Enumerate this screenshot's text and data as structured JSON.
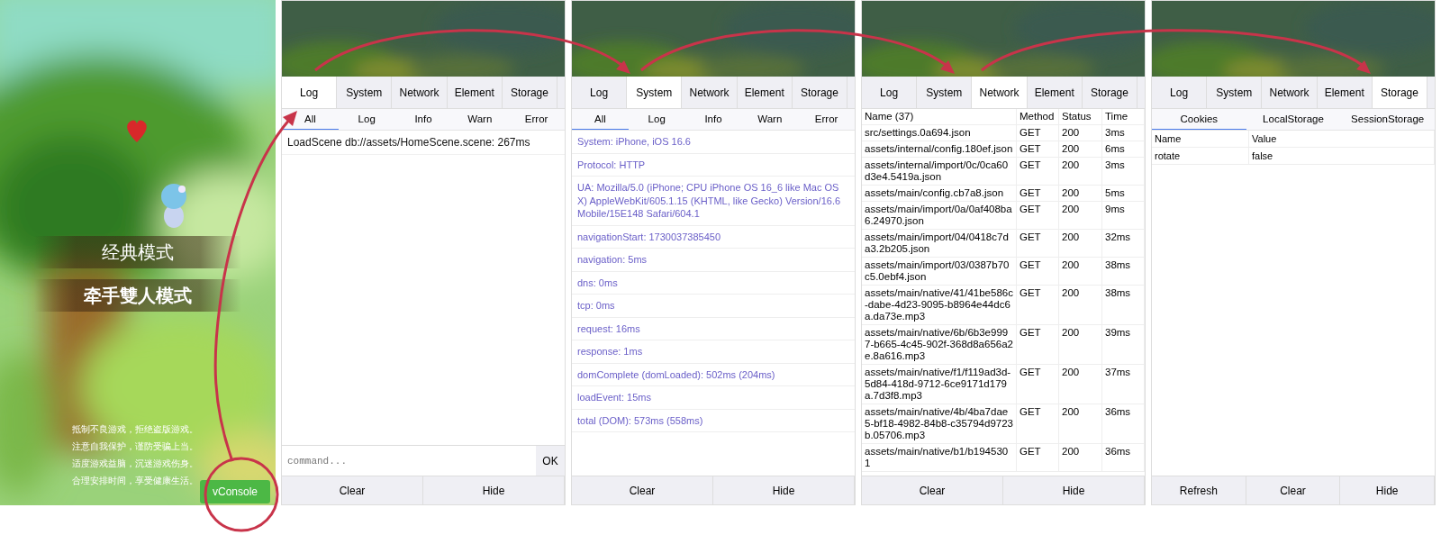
{
  "game": {
    "modes": [
      {
        "label": "经典模式",
        "bold": false
      },
      {
        "label": "牵手雙人模式",
        "bold": true
      }
    ],
    "notice": [
      "抵制不良游戏，拒绝盗版游戏。",
      "注意自我保护，谨防受骗上当。",
      "适度游戏益脑，沉迷游戏伤身。",
      "合理安排时间，享受健康生活。"
    ],
    "vconsole_button": "vConsole"
  },
  "panels": [
    {
      "kind": "log",
      "tabs": [
        {
          "label": "Log",
          "selected": true
        },
        {
          "label": "System",
          "selected": false
        },
        {
          "label": "Network",
          "selected": false
        },
        {
          "label": "Element",
          "selected": false
        },
        {
          "label": "Storage",
          "selected": false
        }
      ],
      "filters": [
        {
          "label": "All",
          "selected": true
        },
        {
          "label": "Log",
          "selected": false
        },
        {
          "label": "Info",
          "selected": false
        },
        {
          "label": "Warn",
          "selected": false
        },
        {
          "label": "Error",
          "selected": false
        }
      ],
      "lines": [
        "LoadScene db://assets/HomeScene.scene: 267ms"
      ],
      "command": {
        "placeholder": "command...",
        "button": "OK"
      },
      "footer": [
        "Clear",
        "Hide"
      ]
    },
    {
      "kind": "system",
      "tabs": [
        {
          "label": "Log",
          "selected": false
        },
        {
          "label": "System",
          "selected": true
        },
        {
          "label": "Network",
          "selected": false
        },
        {
          "label": "Element",
          "selected": false
        },
        {
          "label": "Storage",
          "selected": false
        }
      ],
      "filters": [
        {
          "label": "All",
          "selected": true
        },
        {
          "label": "Log",
          "selected": false
        },
        {
          "label": "Info",
          "selected": false
        },
        {
          "label": "Warn",
          "selected": false
        },
        {
          "label": "Error",
          "selected": false
        }
      ],
      "lines": [
        "System: iPhone, iOS 16.6",
        "Protocol: HTTP",
        "UA: Mozilla/5.0 (iPhone; CPU iPhone OS 16_6 like Mac OS X) AppleWebKit/605.1.15 (KHTML, like Gecko) Version/16.6 Mobile/15E148 Safari/604.1",
        "navigationStart: 1730037385450",
        "navigation: 5ms",
        "dns: 0ms",
        "tcp: 0ms",
        "request: 16ms",
        "response: 1ms",
        "domComplete (domLoaded): 502ms (204ms)",
        "loadEvent: 15ms",
        "total (DOM): 573ms (558ms)"
      ],
      "footer": [
        "Clear",
        "Hide"
      ]
    },
    {
      "kind": "network",
      "tabs": [
        {
          "label": "Log",
          "selected": false
        },
        {
          "label": "System",
          "selected": false
        },
        {
          "label": "Network",
          "selected": true
        },
        {
          "label": "Element",
          "selected": false
        },
        {
          "label": "Storage",
          "selected": false
        }
      ],
      "columns": [
        "Name (37)",
        "Method",
        "Status",
        "Time"
      ],
      "rows": [
        [
          "src/settings.0a694.json",
          "GET",
          "200",
          "3ms"
        ],
        [
          "assets/internal/config.180ef.json",
          "GET",
          "200",
          "6ms"
        ],
        [
          "assets/internal/import/0c/0ca60d3e4.5419a.json",
          "GET",
          "200",
          "3ms"
        ],
        [
          "assets/main/config.cb7a8.json",
          "GET",
          "200",
          "5ms"
        ],
        [
          "assets/main/import/0a/0af408ba6.24970.json",
          "GET",
          "200",
          "9ms"
        ],
        [
          "assets/main/import/04/0418c7da3.2b205.json",
          "GET",
          "200",
          "32ms"
        ],
        [
          "assets/main/import/03/0387b70c5.0ebf4.json",
          "GET",
          "200",
          "38ms"
        ],
        [
          "assets/main/native/41/41be586c-dabe-4d23-9095-b8964e44dc6a.da73e.mp3",
          "GET",
          "200",
          "38ms"
        ],
        [
          "assets/main/native/6b/6b3e9997-b665-4c45-902f-368d8a656a2e.8a616.mp3",
          "GET",
          "200",
          "39ms"
        ],
        [
          "assets/main/native/f1/f119ad3d-5d84-418d-9712-6ce9171d179a.7d3f8.mp3",
          "GET",
          "200",
          "37ms"
        ],
        [
          "assets/main/native/4b/4ba7dae5-bf18-4982-84b8-c35794d9723b.05706.mp3",
          "GET",
          "200",
          "36ms"
        ],
        [
          "assets/main/native/b1/b1945301",
          "GET",
          "200",
          "36ms"
        ]
      ],
      "footer": [
        "Clear",
        "Hide"
      ]
    },
    {
      "kind": "storage",
      "tabs": [
        {
          "label": "Log",
          "selected": false
        },
        {
          "label": "System",
          "selected": false
        },
        {
          "label": "Network",
          "selected": false
        },
        {
          "label": "Element",
          "selected": false
        },
        {
          "label": "Storage",
          "selected": true
        }
      ],
      "filters": [
        {
          "label": "Cookies",
          "selected": true
        },
        {
          "label": "LocalStorage",
          "selected": false
        },
        {
          "label": "SessionStorage",
          "selected": false
        }
      ],
      "columns": [
        "Name",
        "Value"
      ],
      "rows": [
        [
          "rotate",
          "false"
        ]
      ],
      "footer": [
        "Refresh",
        "Clear",
        "Hide"
      ]
    }
  ]
}
